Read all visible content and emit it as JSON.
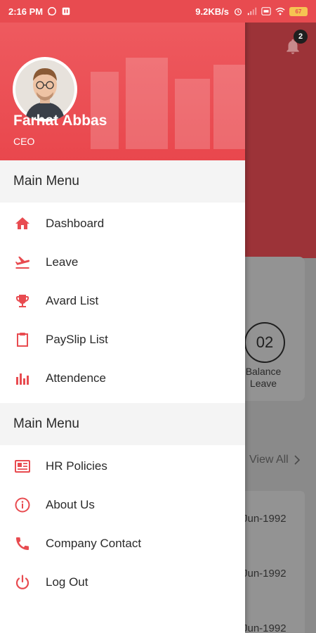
{
  "status_bar": {
    "time": "2:16 PM",
    "network_speed": "9.2KB/s",
    "battery_level": "67"
  },
  "background": {
    "notification_count": "2",
    "balance_value": "02",
    "balance_label": "Balance\nLeave",
    "view_all": "View All",
    "dates": [
      "-Jun-1992",
      "-Jun-1992",
      "-Jun-1992"
    ]
  },
  "drawer": {
    "user_name": "Farhat Abbas",
    "user_role": "CEO",
    "sections": [
      {
        "title": "Main Menu",
        "items": [
          {
            "label": "Dashboard",
            "icon": "home-icon"
          },
          {
            "label": "Leave",
            "icon": "airplane-icon"
          },
          {
            "label": "Avard List",
            "icon": "trophy-icon"
          },
          {
            "label": "PaySlip List",
            "icon": "clipboard-icon"
          },
          {
            "label": "Attendence",
            "icon": "bar-chart-icon"
          }
        ]
      },
      {
        "title": "Main Menu",
        "items": [
          {
            "label": "HR Policies",
            "icon": "newspaper-icon"
          },
          {
            "label": "About Us",
            "icon": "info-icon"
          },
          {
            "label": "Company Contact",
            "icon": "phone-icon"
          },
          {
            "label": "Log Out",
            "icon": "power-icon"
          }
        ]
      }
    ]
  },
  "colors": {
    "accent": "#e84b50",
    "drawer_bg": "#ffffff",
    "section_bg": "#f4f4f4",
    "scrim": "#8a8a8a"
  }
}
